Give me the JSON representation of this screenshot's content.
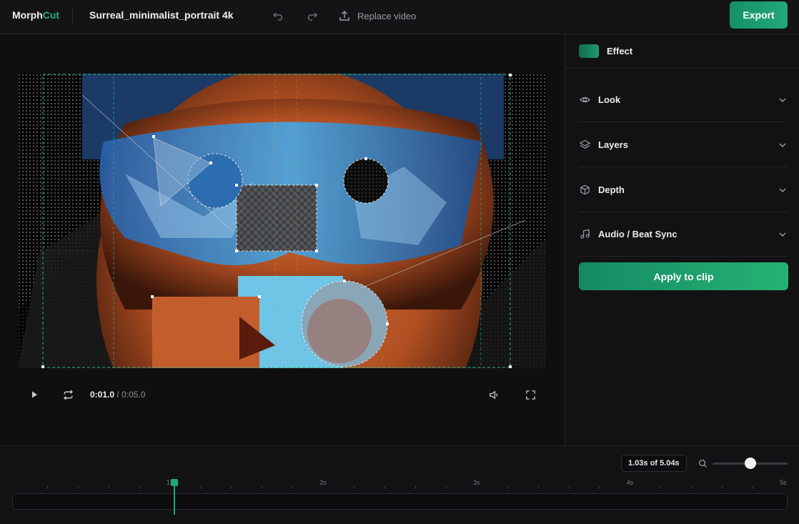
{
  "app": {
    "logo_main": "Morph",
    "logo_accent": "Cut",
    "project_title": "Surreal_minimalist_portrait 4k",
    "replace_label": "Replace video",
    "export_label": "Export",
    "accent_color": "#1fa776"
  },
  "player": {
    "current_time": "0:01.0",
    "separator": " / ",
    "total_time": "0:05.0"
  },
  "panel": {
    "title": "Effect",
    "sections": [
      {
        "label": "Look",
        "icon": "eye-icon"
      },
      {
        "label": "Layers",
        "icon": "layers-icon"
      },
      {
        "label": "Depth",
        "icon": "cube-icon"
      },
      {
        "label": "Audio / Beat Sync",
        "icon": "music-icon"
      }
    ],
    "apply_label": "Apply to clip"
  },
  "timeline": {
    "position_badge": "1.03s of 5.04s",
    "zoom_level": 0.5,
    "playhead_seconds": 1.03,
    "duration_seconds": 5.04,
    "ticks": [
      "1s",
      "2s",
      "3s",
      "4s",
      "5s"
    ]
  }
}
